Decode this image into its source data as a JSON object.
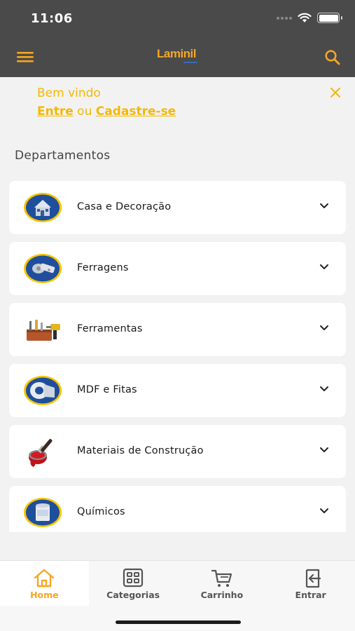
{
  "status_bar": {
    "time": "11:06"
  },
  "app_bar": {
    "logo_text": "Laminil",
    "menu_icon": "hamburger-menu-icon",
    "search_icon": "search-icon",
    "accent_color": "#f5a623",
    "background_color": "#4a4a4a"
  },
  "welcome": {
    "title": "Bem vindo",
    "login_link": "Entre",
    "connector": "ou",
    "signup_link": "Cadastre-se",
    "close_icon": "close-icon",
    "text_color": "#f5b800"
  },
  "departments": {
    "heading": "Departamentos",
    "items": [
      {
        "label": "Casa e Decoração",
        "icon": "house-icon"
      },
      {
        "label": "Ferragens",
        "icon": "hinge-icon"
      },
      {
        "label": "Ferramentas",
        "icon": "tools-icon"
      },
      {
        "label": "MDF e Fitas",
        "icon": "edge-tape-icon"
      },
      {
        "label": "Materiais de Construção",
        "icon": "paint-brush-icon"
      },
      {
        "label": "Químicos",
        "icon": "paint-can-icon"
      }
    ]
  },
  "tab_bar": {
    "tabs": [
      {
        "label": "Home",
        "icon": "home-icon",
        "active": true
      },
      {
        "label": "Categorias",
        "icon": "grid-icon",
        "active": false
      },
      {
        "label": "Carrinho",
        "icon": "cart-icon",
        "active": false
      },
      {
        "label": "Entrar",
        "icon": "login-icon",
        "active": false
      }
    ]
  }
}
